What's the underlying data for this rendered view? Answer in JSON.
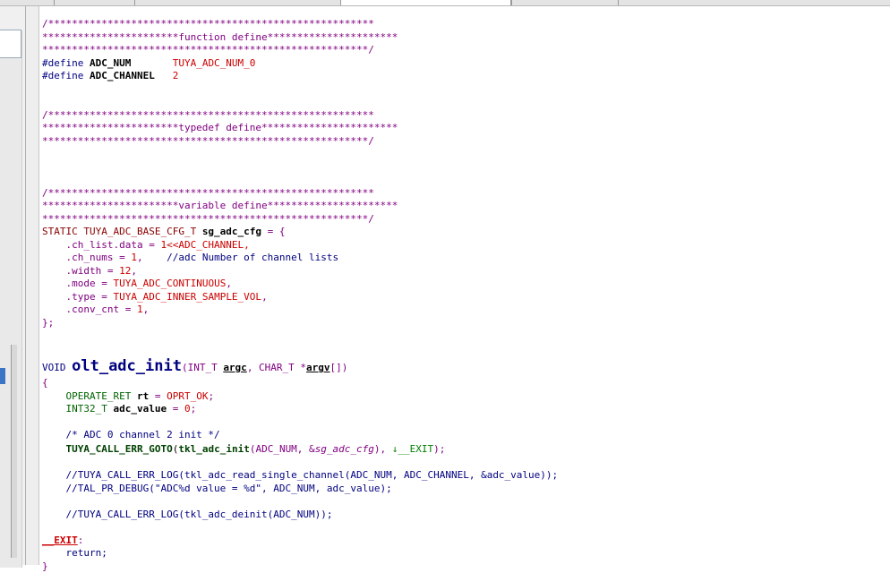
{
  "editor": {
    "lines": [
      [
        {
          "t": "/*******************************************************",
          "c": "cm"
        }
      ],
      [
        {
          "t": "***********************function define**********************",
          "c": "cm"
        }
      ],
      [
        {
          "t": "*******************************************************/",
          "c": "cm"
        }
      ],
      [
        {
          "t": "#define ",
          "c": "kw"
        },
        {
          "t": "ADC_NUM       ",
          "c": "bold"
        },
        {
          "t": "TUYA_ADC_NUM_0",
          "c": "rd"
        }
      ],
      [
        {
          "t": "#define ",
          "c": "kw"
        },
        {
          "t": "ADC_CHANNEL   ",
          "c": "bold"
        },
        {
          "t": "2",
          "c": "rd"
        }
      ],
      [
        {
          "t": "",
          "c": ""
        }
      ],
      [
        {
          "t": "",
          "c": ""
        }
      ],
      [
        {
          "t": "/*******************************************************",
          "c": "cm"
        }
      ],
      [
        {
          "t": "***********************typedef define***********************",
          "c": "cm"
        }
      ],
      [
        {
          "t": "*******************************************************/",
          "c": "cm"
        }
      ],
      [
        {
          "t": "",
          "c": ""
        }
      ],
      [
        {
          "t": "",
          "c": ""
        }
      ],
      [
        {
          "t": "",
          "c": ""
        }
      ],
      [
        {
          "t": "/*******************************************************",
          "c": "cm"
        }
      ],
      [
        {
          "t": "***********************variable define**********************",
          "c": "cm"
        }
      ],
      [
        {
          "t": "*******************************************************/",
          "c": "cm"
        }
      ],
      [
        {
          "t": "STATIC TUYA_ADC_BASE_CFG_T ",
          "c": "tp"
        },
        {
          "t": "sg_adc_cfg",
          "c": "bold"
        },
        {
          "t": " = {",
          "c": "cm"
        }
      ],
      [
        {
          "t": "    .ch_list.data = ",
          "c": "cm"
        },
        {
          "t": "1<<ADC_CHANNEL,",
          "c": "rd"
        }
      ],
      [
        {
          "t": "    .ch_nums = ",
          "c": "cm"
        },
        {
          "t": "1",
          "c": "rd"
        },
        {
          "t": ",    ",
          "c": "cm"
        },
        {
          "t": "//adc Number of channel lists",
          "c": "kw"
        }
      ],
      [
        {
          "t": "    .width = ",
          "c": "cm"
        },
        {
          "t": "12",
          "c": "rd"
        },
        {
          "t": ",",
          "c": "cm"
        }
      ],
      [
        {
          "t": "    .mode = ",
          "c": "cm"
        },
        {
          "t": "TUYA_ADC_CONTINUOUS",
          "c": "rd"
        },
        {
          "t": ",",
          "c": "cm"
        }
      ],
      [
        {
          "t": "    .type = ",
          "c": "cm"
        },
        {
          "t": "TUYA_ADC_INNER_SAMPLE_VOL",
          "c": "rd"
        },
        {
          "t": ",",
          "c": "cm"
        }
      ],
      [
        {
          "t": "    .conv_cnt = ",
          "c": "cm"
        },
        {
          "t": "1",
          "c": "rd"
        },
        {
          "t": ",",
          "c": "cm"
        }
      ],
      [
        {
          "t": "};",
          "c": "cm"
        }
      ],
      [
        {
          "t": "",
          "c": ""
        }
      ],
      [
        {
          "t": "",
          "c": ""
        }
      ],
      [
        {
          "t": "VOID ",
          "c": "kw"
        },
        {
          "t": "olt_adc_init",
          "c": "fn"
        },
        {
          "t": "(INT_T ",
          "c": "cm"
        },
        {
          "t": "argc",
          "c": "bold ul"
        },
        {
          "t": ", CHAR_T *",
          "c": "cm"
        },
        {
          "t": "argv",
          "c": "bold ul"
        },
        {
          "t": "[])",
          "c": "cm"
        }
      ],
      [
        {
          "t": "{",
          "c": "cm"
        }
      ],
      [
        {
          "t": "    ",
          "c": ""
        },
        {
          "t": "OPERATE_RET ",
          "c": "cc"
        },
        {
          "t": "rt",
          "c": "bold"
        },
        {
          "t": " = ",
          "c": "cm"
        },
        {
          "t": "OPRT_OK",
          "c": "rd"
        },
        {
          "t": ";",
          "c": "cm"
        }
      ],
      [
        {
          "t": "    ",
          "c": ""
        },
        {
          "t": "INT32_T ",
          "c": "cc"
        },
        {
          "t": "adc_value",
          "c": "bold"
        },
        {
          "t": " = ",
          "c": "cm"
        },
        {
          "t": "0",
          "c": "rd"
        },
        {
          "t": ";",
          "c": "cm"
        }
      ],
      [
        {
          "t": "",
          "c": ""
        }
      ],
      [
        {
          "t": "    /* ADC 0 channel 2 init */",
          "c": "kw"
        }
      ],
      [
        {
          "t": "    ",
          "c": ""
        },
        {
          "t": "TUYA_CALL_ERR_GOTO",
          "c": "fcall"
        },
        {
          "t": "(",
          "c": ""
        },
        {
          "t": "tkl_adc_init",
          "c": "fcall"
        },
        {
          "t": "(ADC_NUM, &",
          "c": "cm"
        },
        {
          "t": "sg_adc_cfg",
          "c": "it"
        },
        {
          "t": "), ",
          "c": "cm"
        },
        {
          "t": "↓__EXIT",
          "c": "gr"
        },
        {
          "t": ");",
          "c": "cm"
        }
      ],
      [
        {
          "t": "",
          "c": ""
        }
      ],
      [
        {
          "t": "    //TUYA_CALL_ERR_LOG(tkl_adc_read_single_channel(ADC_NUM, ADC_CHANNEL, &adc_value));",
          "c": "kw"
        }
      ],
      [
        {
          "t": "    //TAL_PR_DEBUG(\"ADC%d value = %d\", ADC_NUM, adc_value);",
          "c": "kw"
        }
      ],
      [
        {
          "t": "",
          "c": ""
        }
      ],
      [
        {
          "t": "    //TUYA_CALL_ERR_LOG(tkl_adc_deinit(ADC_NUM));",
          "c": "kw"
        }
      ],
      [
        {
          "t": "",
          "c": ""
        }
      ],
      [
        {
          "t": "__EXIT",
          "c": "lbl"
        },
        {
          "t": ":",
          "c": "cm"
        }
      ],
      [
        {
          "t": "    return;",
          "c": "kw"
        }
      ],
      [
        {
          "t": "}",
          "c": "cm"
        }
      ]
    ]
  }
}
